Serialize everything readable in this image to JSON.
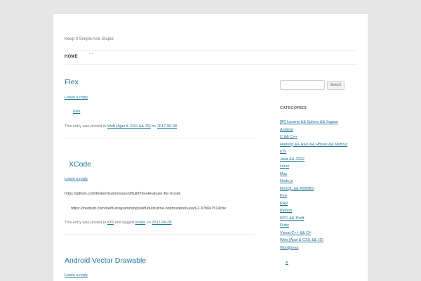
{
  "site": {
    "tagline": "Keep It Simple And Stupid"
  },
  "nav": {
    "home": "HOME",
    "extra": "\" \""
  },
  "posts": [
    {
      "title": "Flex",
      "reply": "Leave a reply",
      "content_link": "Flex",
      "meta_prefix": "This entry was posted in",
      "category": "Web   (Ajax & CSS && JS)",
      "meta_on": "on",
      "date": "2017-06-08"
    },
    {
      "title": "XCode",
      "reply": "Leave a reply",
      "line1": "https://github.com/RobertGummesson/BuildTimeAnalyzer-for-Xcode",
      "line2": "https://medium.com/swift-programming/swift-build-time-optimizations-part-2-37b0a7514cbe",
      "meta_prefix": "This entry was posted in",
      "category": "iOS",
      "meta_tagged": "and tagged",
      "tag": "xcode",
      "meta_on": "on",
      "date": "2017-06-08"
    },
    {
      "title": "Android Vector Drawable",
      "reply": "Leave a reply"
    }
  ],
  "sidebar": {
    "search_button": "Search",
    "categories_heading": "CATEGORIES",
    "categories": [
      "[IR] Lucene && Sphinx && Xapian",
      "Android",
      "C && C++",
      "Hadoop && Hive && HBase && Mahout",
      "iOS",
      "Java && J2EE",
      "Linux",
      "Mac",
      "Node.js",
      "NoSQL && RDMBS",
      "Perl",
      "PHP",
      "Python",
      "RPC && Thrift",
      "Ruby",
      "Visual C++ && C#",
      "Web   (Ajax & CSS && JS)",
      "Wordpress",
      "",
      "&",
      "",
      ""
    ]
  }
}
